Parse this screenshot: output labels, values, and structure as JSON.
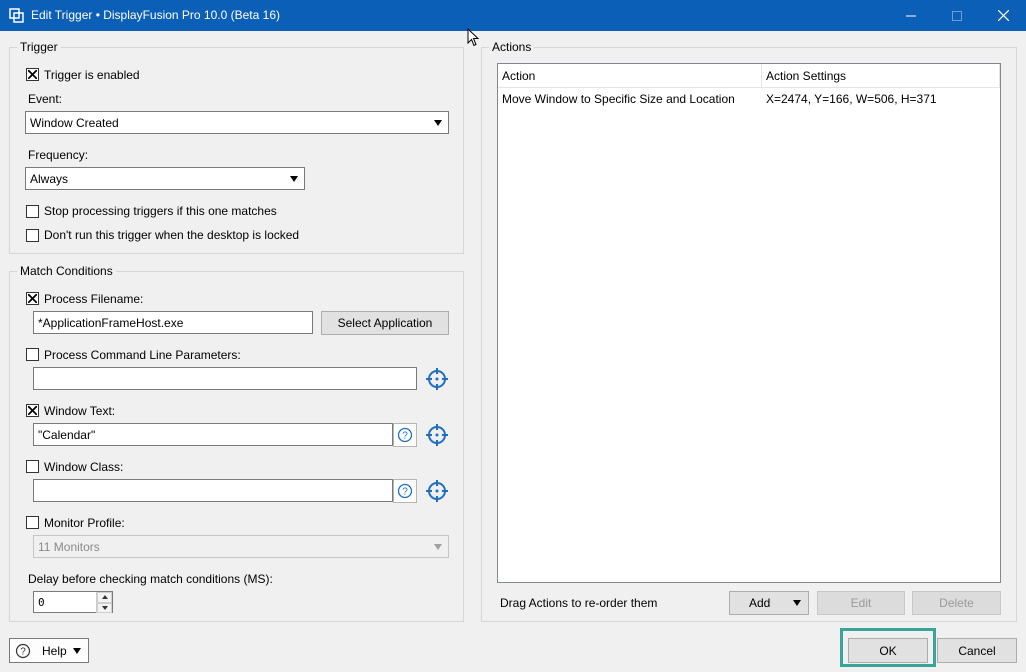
{
  "window": {
    "title": "Edit Trigger • DisplayFusion Pro 10.0 (Beta 16)",
    "minimize_icon": "minimize-icon",
    "maximize_icon": "maximize-icon",
    "close_icon": "close-icon"
  },
  "trigger_group": {
    "label": "Trigger",
    "enabled_label": "Trigger is enabled",
    "enabled_checked": true,
    "event_label": "Event:",
    "event_value": "Window Created",
    "frequency_label": "Frequency:",
    "frequency_value": "Always",
    "stop_processing_label": "Stop processing triggers if this one matches",
    "stop_processing_checked": false,
    "desktop_locked_label": "Don't run this trigger when the desktop is locked",
    "desktop_locked_checked": false
  },
  "match_group": {
    "label": "Match Conditions",
    "process_filename_label": "Process Filename:",
    "process_filename_checked": true,
    "process_filename_value": "*ApplicationFrameHost.exe",
    "select_application_label": "Select Application",
    "cmdline_label": "Process Command Line Parameters:",
    "cmdline_checked": false,
    "cmdline_value": "",
    "window_text_label": "Window Text:",
    "window_text_checked": true,
    "window_text_value": "\"Calendar\"",
    "window_class_label": "Window Class:",
    "window_class_checked": false,
    "window_class_value": "",
    "monitor_profile_label": "Monitor Profile:",
    "monitor_profile_checked": false,
    "monitor_profile_value": "11 Monitors",
    "delay_label": "Delay before checking match conditions (MS):",
    "delay_value": "0"
  },
  "actions_group": {
    "label": "Actions",
    "columns": [
      "Action",
      "Action Settings"
    ],
    "rows": [
      {
        "action": "Move Window to Specific Size and Location",
        "settings": "X=2474, Y=166, W=506, H=371"
      }
    ],
    "hint": "Drag Actions to re-order them",
    "add_label": "Add",
    "edit_label": "Edit",
    "delete_label": "Delete"
  },
  "footer": {
    "help_label": "Help",
    "ok_label": "OK",
    "cancel_label": "Cancel"
  },
  "colors": {
    "titlebar": "#0b5fb6",
    "accent_icon": "#1e6fc4",
    "ok_highlight": "#3aa39a"
  }
}
